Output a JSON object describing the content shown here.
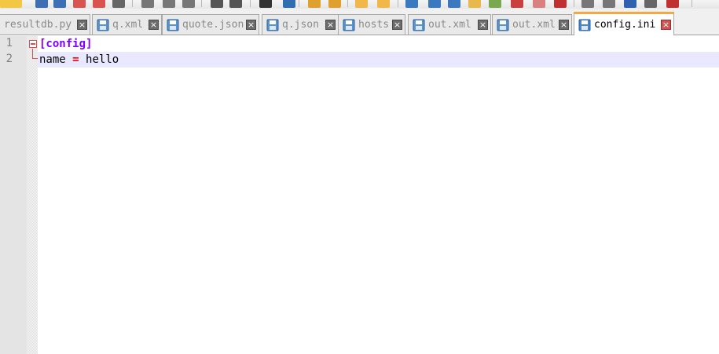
{
  "toolbar": {
    "buttons": [
      {
        "name": "new-file-icon",
        "color": "#f2c744"
      },
      {
        "name": "open-file-icon",
        "color": "#f2c744"
      },
      {
        "name": "save-icon",
        "color": "#3c6fb4"
      },
      {
        "name": "save-all-icon",
        "color": "#3c6fb4"
      },
      {
        "name": "close-icon",
        "color": "#d9534f"
      },
      {
        "name": "close-all-icon",
        "color": "#d9534f"
      },
      {
        "name": "print-icon",
        "color": "#666666"
      },
      {
        "name": "cut-icon",
        "color": "#777777"
      },
      {
        "name": "copy-icon",
        "color": "#777777"
      },
      {
        "name": "paste-icon",
        "color": "#777777"
      },
      {
        "name": "undo-icon",
        "color": "#555555"
      },
      {
        "name": "redo-icon",
        "color": "#555555"
      },
      {
        "name": "find-icon",
        "color": "#333333"
      },
      {
        "name": "replace-icon",
        "color": "#2f6fb0"
      },
      {
        "name": "zoom-in-icon",
        "color": "#e0a030"
      },
      {
        "name": "zoom-out-icon",
        "color": "#e0a030"
      },
      {
        "name": "sync-v-icon",
        "color": "#f0b848"
      },
      {
        "name": "sync-h-icon",
        "color": "#f0b848"
      },
      {
        "name": "word-wrap-icon",
        "color": "#3a78c0"
      },
      {
        "name": "show-all-icon",
        "color": "#3a78c0"
      },
      {
        "name": "indent-guide-icon",
        "color": "#3a78c0"
      },
      {
        "name": "doc-map-icon",
        "color": "#e8b94a"
      },
      {
        "name": "function-list-icon",
        "color": "#7aa84f"
      },
      {
        "name": "folder-workspace-icon",
        "color": "#c94040"
      },
      {
        "name": "monitoring-icon",
        "color": "#d98080"
      },
      {
        "name": "macro-record-icon",
        "color": "#c03030"
      },
      {
        "name": "macro-stop-icon",
        "color": "#777777"
      },
      {
        "name": "macro-play-icon",
        "color": "#777777"
      },
      {
        "name": "macro-run-multiple-icon",
        "color": "#3060b0"
      },
      {
        "name": "macro-save-icon",
        "color": "#666666"
      },
      {
        "name": "spell-check-icon",
        "color": "#c03030"
      }
    ]
  },
  "tabs": [
    {
      "label": "resultdb.py",
      "active": false,
      "name": "tab-resultdb-py"
    },
    {
      "label": "q.xml",
      "active": false,
      "name": "tab-q-xml"
    },
    {
      "label": "quote.json",
      "active": false,
      "name": "tab-quote-json"
    },
    {
      "label": "q.json",
      "active": false,
      "name": "tab-q-json"
    },
    {
      "label": "hosts",
      "active": false,
      "name": "tab-hosts"
    },
    {
      "label": "out.xml",
      "active": false,
      "name": "tab-out-xml-1"
    },
    {
      "label": "out.xml",
      "active": false,
      "name": "tab-out-xml-2"
    },
    {
      "label": "config.ini",
      "active": true,
      "name": "tab-config-ini"
    }
  ],
  "tab_close_glyph": "×",
  "editor": {
    "lines": [
      {
        "number": "1",
        "tokens": [
          {
            "type": "section",
            "text": "[config]"
          }
        ]
      },
      {
        "number": "2",
        "tokens": [
          {
            "type": "key",
            "text": "name"
          },
          {
            "type": "plain",
            "text": " "
          },
          {
            "type": "assign",
            "text": "="
          },
          {
            "type": "plain",
            "text": " "
          },
          {
            "type": "value",
            "text": "hello"
          }
        ]
      }
    ],
    "current_line": 2
  },
  "colors": {
    "active_tab_accent": "#f7a640",
    "section": "#8000ff",
    "operator": "#ff0000",
    "current_line_bg": "#e8e8ff",
    "fold_marker": "#e24b4b"
  }
}
